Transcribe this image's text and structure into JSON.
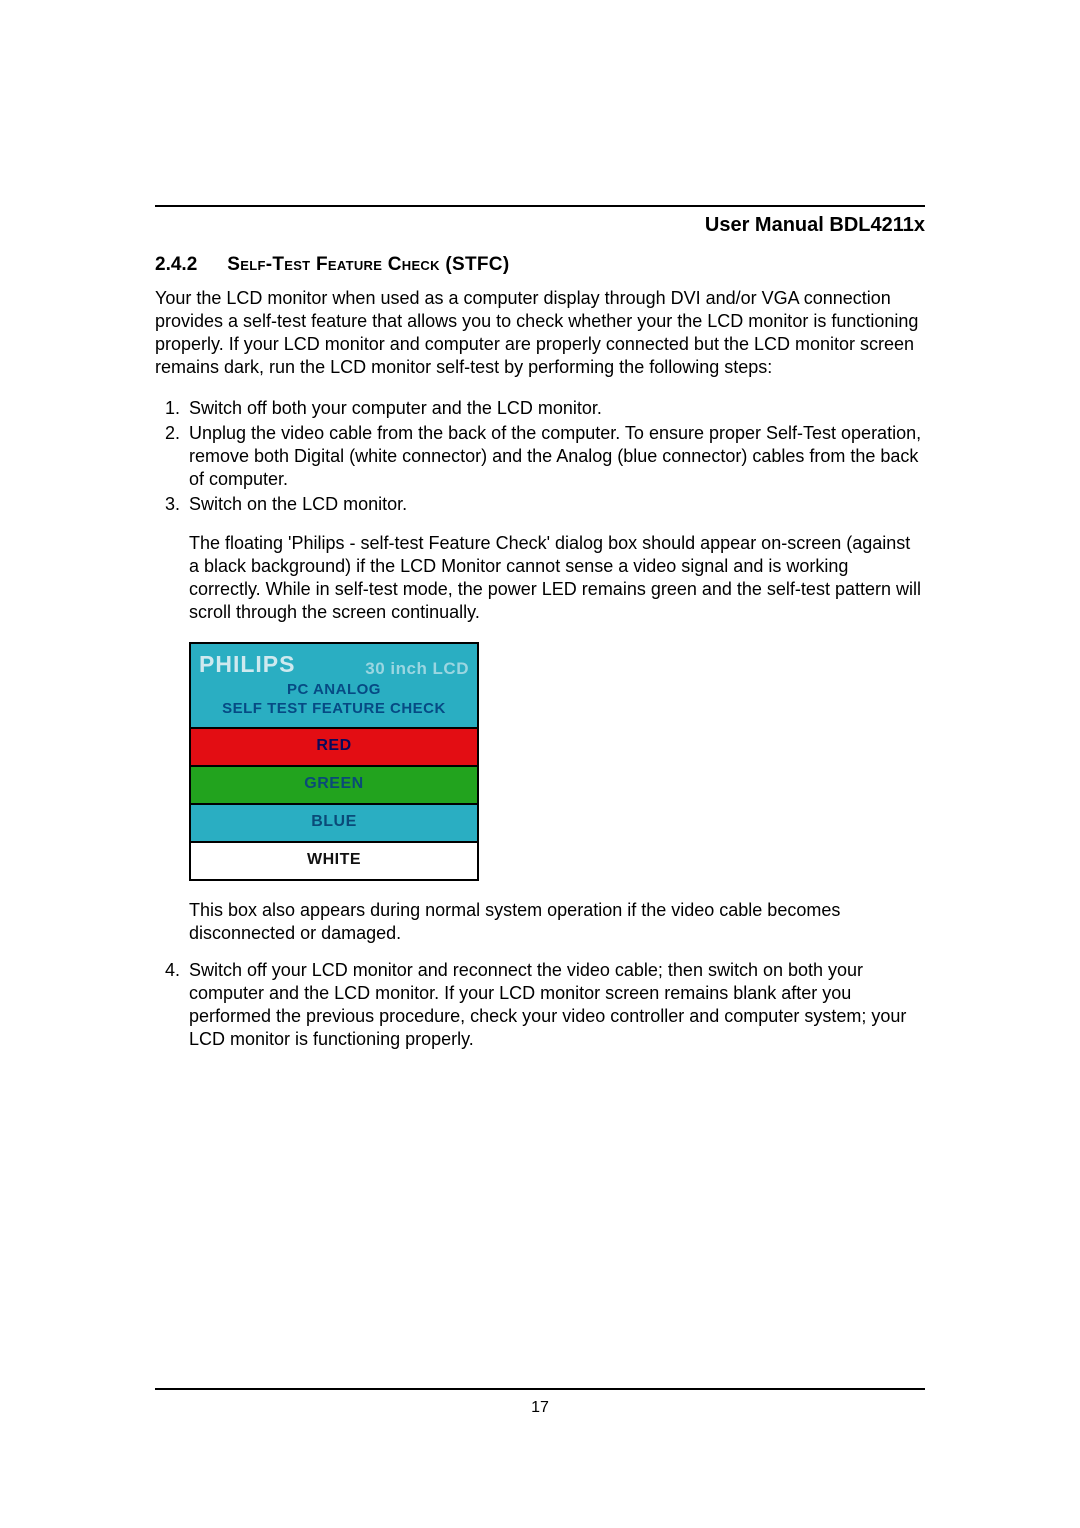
{
  "header": {
    "doc_title": "User Manual BDL4211x"
  },
  "section": {
    "number": "2.4.2",
    "title": "Self-Test Feature Check (STFC)"
  },
  "intro": "Your the LCD monitor when used as a computer display through DVI and/or VGA connection provides a self-test feature that allows you to check whether your the LCD monitor is functioning properly. If your LCD monitor and computer are properly connected but the LCD monitor screen remains dark, run the LCD monitor self-test by performing the following steps:",
  "steps": {
    "s1": "Switch off both your computer and the LCD monitor.",
    "s2": "Unplug the video cable from the back of the computer. To ensure proper Self-Test operation, remove both Digital (white connector) and the Analog (blue connector) cables from the back of computer.",
    "s3": "Switch on the LCD monitor.",
    "s4": "Switch off your LCD monitor and reconnect the video cable; then switch on both your computer and the LCD monitor. If your LCD monitor screen remains blank after you performed the previous procedure, check your video controller and computer system; your LCD monitor is functioning properly."
  },
  "after_step3_note": "The floating 'Philips - self-test Feature Check' dialog box should appear on-screen (against a black background) if the LCD Monitor cannot sense a video signal and is working correctly. While in self-test mode, the power LED remains green and the self-test pattern will scroll through the screen continually.",
  "diagram": {
    "brand": "PHILIPS",
    "lcd_label": "30 inch LCD",
    "line1": "PC ANALOG",
    "line2": "SELF TEST FEATURE CHECK",
    "bars": {
      "red": "RED",
      "green": "GREEN",
      "blue": "BLUE",
      "white": "WHITE"
    }
  },
  "after_diagram_note": "This box also appears during normal system operation if the video cable becomes disconnected or damaged.",
  "footer": {
    "page_number": "17"
  }
}
